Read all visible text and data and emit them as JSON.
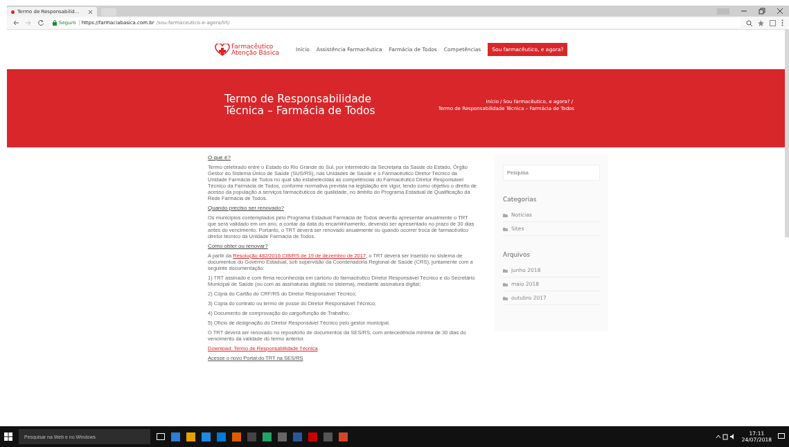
{
  "browser": {
    "tab_title": "Termo de Responsabilid...",
    "secure_label": "Seguro",
    "url_host": "https://farmaciabasica.com.br",
    "url_path": "/sou-farmaceutico-e-agora/trt/"
  },
  "site": {
    "logo_line1": "Farmacêutico",
    "logo_line2": "Atenção Básica",
    "nav": [
      {
        "label": "Início",
        "selected": false
      },
      {
        "label": "Assistência Farmacêutica",
        "selected": false
      },
      {
        "label": "Farmácia de Todos",
        "selected": false
      },
      {
        "label": "Competências",
        "selected": false
      },
      {
        "label": "Sou farmacêutico, e agora?",
        "selected": true
      }
    ]
  },
  "banner": {
    "title": "Termo de Responsabilidade Técnica – Farmácia de Todos",
    "breadcrumb_separator": "/",
    "breadcrumb": [
      "Início",
      "Sou farmacêutico, e agora?",
      "Termo de Responsabilidade Técnica – Farmácia de Todos"
    ]
  },
  "article": [
    {
      "kind": "heading",
      "text": "O que é?"
    },
    {
      "kind": "paragraph",
      "text": "Termo celebrado entre o Estado do Rio Grande do Sul, por intermédio da Secretaria da Saúde do Estado, Órgão Gestor do Sistema Único de Saúde (SUS/RS), nas Unidades de Saúde e o Farmacêutico Diretor Técnico da Unidade Farmácia de Todos no qual são estabelecidas as competências do Farmacêutico Diretor Responsável Técnico da Farmácia de Todos, conforme normativa prevista na legislação em vigor, tendo como objetivo o direito de acesso da população a serviços farmacêuticos de qualidade, no âmbito do Programa Estadual de Qualificação da Rede Farmácia de Todos."
    },
    {
      "kind": "heading",
      "text": "Quando preciso ser renovado?"
    },
    {
      "kind": "paragraph",
      "text": "Os municípios contemplados pelo Programa Estadual Farmácia de Todos deverão apresentar anualmente o TRT que será validado em um ano, a contar da data do encaminhamento, devendo ser apresentado no prazo de 30 dias antes do vencimento. Portanto, o TRT deverá ser renovado anualmente ou quando ocorrer troca de farmacêutico diretor técnico da Unidade Farmácia de Todos."
    },
    {
      "kind": "heading",
      "text": "Como obter ou renovar?"
    },
    {
      "kind": "linked",
      "before": "A partir da ",
      "link": "Resolução 482/2016 CIB/RS de 19 de dezembro de 2017",
      "after": ", o TRT deverá ser inserido no sistema de documentos do Governo Estadual, sob supervisão da Coordenadoria Regional de Saúde (CRS), juntamente com a seguinte documentação:"
    },
    {
      "kind": "paragraph",
      "text": "1) TRT assinado e com firma reconhecida em cartório do farmacêutico Diretor Responsável Técnico e do Secretário Municipal de Saúde (ou com as assinaturas digitais no sistema), mediante assinatura digital;"
    },
    {
      "kind": "paragraph",
      "text": "2) Cópia do Cartão do CRF/RS do Diretor Responsável Técnico;"
    },
    {
      "kind": "paragraph",
      "text": "3) Cópia do contrato ou termo de posse do Diretor Responsável Técnico;"
    },
    {
      "kind": "paragraph",
      "text": "4) Documento de comprovação do cargo/função de Trabalho;"
    },
    {
      "kind": "paragraph",
      "text": "5) Ofício de designação do Diretor Responsável Técnico pelo gestor municipal."
    },
    {
      "kind": "paragraph",
      "text": "O TRT deverá ser renovado no repositório de documentos da SES/RS, com antecedência mínima de 30 dias do vencimento da validade do termo anterior."
    },
    {
      "kind": "link",
      "text": "Download: Termo de Responsabilidade Técnica",
      "red": true
    },
    {
      "kind": "link",
      "text": "Acesse o novo Portal do TRT na SES/RS",
      "red": false
    }
  ],
  "sidebar": {
    "search_placeholder": "Pesquisa",
    "widgets": [
      {
        "title": "Categorias",
        "items": [
          "Notícias",
          "Sites"
        ]
      },
      {
        "title": "Arquivos",
        "items": [
          "junho 2018",
          "maio 2018",
          "outubro 2017"
        ]
      }
    ]
  },
  "taskbar": {
    "search_placeholder": "Pesquisar na Web e no Windows",
    "time": "17:11",
    "date": "24/07/2018"
  }
}
